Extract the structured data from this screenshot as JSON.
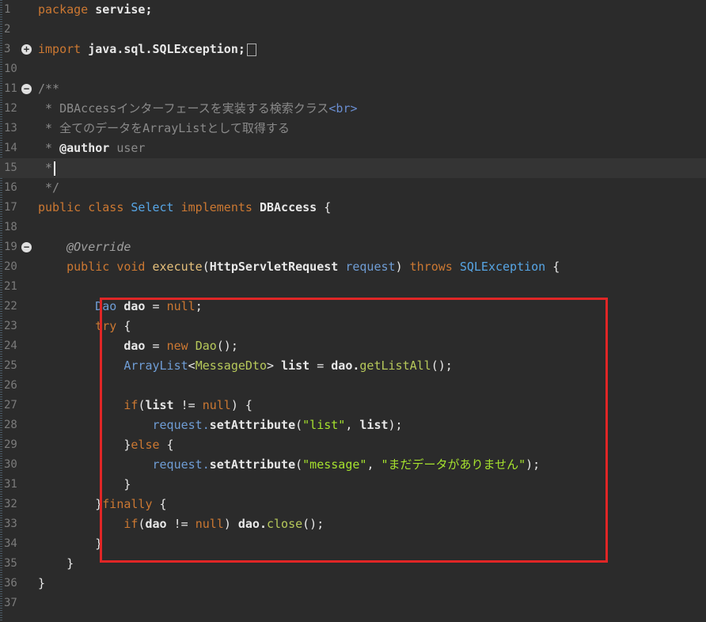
{
  "editor": {
    "lines": [
      {
        "num": "1",
        "tokens": [
          {
            "t": "package ",
            "c": "kw"
          },
          {
            "t": "servise;",
            "c": "id"
          }
        ]
      },
      {
        "num": "2",
        "tokens": []
      },
      {
        "num": "3",
        "fold": "+",
        "tokens": [
          {
            "t": "import ",
            "c": "kw"
          },
          {
            "t": "java.sql.SQLException;",
            "c": "id"
          }
        ],
        "box": true
      },
      {
        "num": "10",
        "tokens": []
      },
      {
        "num": "11",
        "fold": "-",
        "tokens": [
          {
            "t": "/**",
            "c": "cmt"
          }
        ]
      },
      {
        "num": "12",
        "tokens": [
          {
            "t": " * DBAccessインターフェースを実装する検索クラス",
            "c": "cmt"
          },
          {
            "t": "<br>",
            "c": "tag"
          }
        ]
      },
      {
        "num": "13",
        "tokens": [
          {
            "t": " * 全てのデータをArrayListとして取得する",
            "c": "cmt"
          }
        ]
      },
      {
        "num": "14",
        "tokens": [
          {
            "t": " * ",
            "c": "cmt"
          },
          {
            "t": "@author",
            "c": "id"
          },
          {
            "t": " user",
            "c": "cmt"
          }
        ]
      },
      {
        "num": "15",
        "current": true,
        "caret": true,
        "tokens": [
          {
            "t": " *",
            "c": "cmt"
          }
        ]
      },
      {
        "num": "16",
        "tokens": [
          {
            "t": " */",
            "c": "cmt"
          }
        ]
      },
      {
        "num": "17",
        "tokens": [
          {
            "t": "public class ",
            "c": "kw"
          },
          {
            "t": "Select ",
            "c": "cls"
          },
          {
            "t": "implements ",
            "c": "kw"
          },
          {
            "t": "DBAccess",
            "c": "id"
          },
          {
            "t": " {",
            "c": "pl"
          }
        ]
      },
      {
        "num": "18",
        "tokens": []
      },
      {
        "num": "19",
        "fold": "-",
        "tokens": [
          {
            "t": "    ",
            "c": "pl"
          },
          {
            "t": "@Override",
            "c": "ann"
          }
        ]
      },
      {
        "num": "20",
        "tokens": [
          {
            "t": "    public void ",
            "c": "kw"
          },
          {
            "t": "execute",
            "c": "method"
          },
          {
            "t": "(",
            "c": "pl"
          },
          {
            "t": "HttpServletRequest ",
            "c": "id"
          },
          {
            "t": "request",
            "c": "type"
          },
          {
            "t": ") ",
            "c": "pl"
          },
          {
            "t": "throws ",
            "c": "kw"
          },
          {
            "t": "SQLException",
            "c": "cls"
          },
          {
            "t": " {",
            "c": "pl"
          }
        ]
      },
      {
        "num": "21",
        "tokens": []
      },
      {
        "num": "22",
        "tokens": [
          {
            "t": "        ",
            "c": "pl"
          },
          {
            "t": "Dao ",
            "c": "type"
          },
          {
            "t": "dao",
            "c": "id"
          },
          {
            "t": " = ",
            "c": "pl"
          },
          {
            "t": "null",
            "c": "kw"
          },
          {
            "t": ";",
            "c": "pl"
          }
        ]
      },
      {
        "num": "23",
        "tokens": [
          {
            "t": "        ",
            "c": "pl"
          },
          {
            "t": "try",
            "c": "kw"
          },
          {
            "t": " {",
            "c": "pl"
          }
        ]
      },
      {
        "num": "24",
        "tokens": [
          {
            "t": "            ",
            "c": "pl"
          },
          {
            "t": "dao",
            "c": "id"
          },
          {
            "t": " = ",
            "c": "pl"
          },
          {
            "t": "new ",
            "c": "kw"
          },
          {
            "t": "Dao",
            "c": "gen"
          },
          {
            "t": "();",
            "c": "pl"
          }
        ]
      },
      {
        "num": "25",
        "tokens": [
          {
            "t": "            ",
            "c": "pl"
          },
          {
            "t": "ArrayList",
            "c": "type"
          },
          {
            "t": "<",
            "c": "pl"
          },
          {
            "t": "MessageDto",
            "c": "gen"
          },
          {
            "t": "> ",
            "c": "pl"
          },
          {
            "t": "list",
            "c": "id"
          },
          {
            "t": " = ",
            "c": "pl"
          },
          {
            "t": "dao.",
            "c": "id"
          },
          {
            "t": "getListAll",
            "c": "gen"
          },
          {
            "t": "();",
            "c": "pl"
          }
        ]
      },
      {
        "num": "26",
        "tokens": []
      },
      {
        "num": "27",
        "tokens": [
          {
            "t": "            ",
            "c": "pl"
          },
          {
            "t": "if",
            "c": "kw"
          },
          {
            "t": "(",
            "c": "pl"
          },
          {
            "t": "list",
            "c": "id"
          },
          {
            "t": " != ",
            "c": "pl"
          },
          {
            "t": "null",
            "c": "kw"
          },
          {
            "t": ") {",
            "c": "pl"
          }
        ]
      },
      {
        "num": "28",
        "tokens": [
          {
            "t": "                ",
            "c": "pl"
          },
          {
            "t": "request.",
            "c": "type"
          },
          {
            "t": "setAttribute",
            "c": "id"
          },
          {
            "t": "(",
            "c": "pl"
          },
          {
            "t": "\"list\"",
            "c": "str"
          },
          {
            "t": ", ",
            "c": "pl"
          },
          {
            "t": "list",
            "c": "id"
          },
          {
            "t": ");",
            "c": "pl"
          }
        ]
      },
      {
        "num": "29",
        "tokens": [
          {
            "t": "            }",
            "c": "pl"
          },
          {
            "t": "else",
            "c": "kw"
          },
          {
            "t": " {",
            "c": "pl"
          }
        ]
      },
      {
        "num": "30",
        "tokens": [
          {
            "t": "                ",
            "c": "pl"
          },
          {
            "t": "request.",
            "c": "type"
          },
          {
            "t": "setAttribute",
            "c": "id"
          },
          {
            "t": "(",
            "c": "pl"
          },
          {
            "t": "\"message\"",
            "c": "str"
          },
          {
            "t": ", ",
            "c": "pl"
          },
          {
            "t": "\"まだデータがありません\"",
            "c": "str"
          },
          {
            "t": ");",
            "c": "pl"
          }
        ]
      },
      {
        "num": "31",
        "tokens": [
          {
            "t": "            }",
            "c": "pl"
          }
        ]
      },
      {
        "num": "32",
        "tokens": [
          {
            "t": "        }",
            "c": "pl"
          },
          {
            "t": "finally",
            "c": "kw"
          },
          {
            "t": " {",
            "c": "pl"
          }
        ]
      },
      {
        "num": "33",
        "tokens": [
          {
            "t": "            ",
            "c": "pl"
          },
          {
            "t": "if",
            "c": "kw"
          },
          {
            "t": "(",
            "c": "pl"
          },
          {
            "t": "dao",
            "c": "id"
          },
          {
            "t": " != ",
            "c": "pl"
          },
          {
            "t": "null",
            "c": "kw"
          },
          {
            "t": ") ",
            "c": "pl"
          },
          {
            "t": "dao.",
            "c": "id"
          },
          {
            "t": "close",
            "c": "gen"
          },
          {
            "t": "();",
            "c": "pl"
          }
        ]
      },
      {
        "num": "34",
        "tokens": [
          {
            "t": "        }",
            "c": "pl"
          }
        ]
      },
      {
        "num": "35",
        "tokens": [
          {
            "t": "    }",
            "c": "pl"
          }
        ]
      },
      {
        "num": "36",
        "tokens": [
          {
            "t": "}",
            "c": "pl"
          }
        ]
      },
      {
        "num": "37",
        "tokens": []
      }
    ]
  },
  "colors": {
    "background": "#2b2b2b",
    "highlight_box": "#e02626",
    "keyword": "#cc7832",
    "comment": "#8a8a8a",
    "string": "#a6e22e"
  },
  "icons": {
    "fold_expand": "plus-circle-icon",
    "fold_collapse": "minus-circle-icon",
    "folded_import": "folded-box-icon"
  }
}
